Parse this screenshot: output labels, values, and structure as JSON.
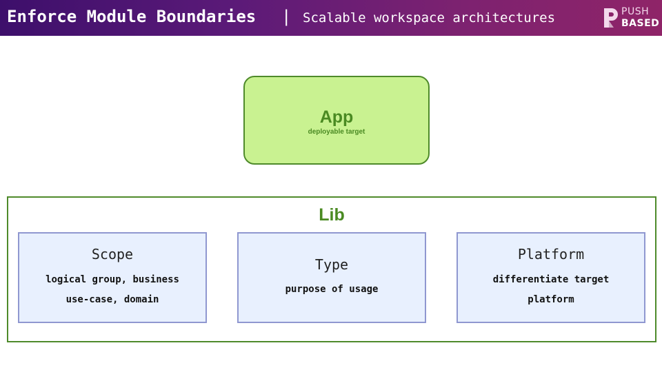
{
  "header": {
    "title": "Enforce Module Boundaries",
    "separator": "|",
    "subtitle": "Scalable workspace architectures",
    "logo": {
      "line1": "PUSH",
      "line2": "BASED",
      "icon": "push-based-logo-icon"
    }
  },
  "app": {
    "title": "App",
    "subtitle": "deployable target"
  },
  "lib": {
    "title": "Lib",
    "cards": [
      {
        "title": "Scope",
        "lines": [
          "logical group, business",
          "use-case, domain"
        ]
      },
      {
        "title": "Type",
        "lines": [
          "purpose of usage"
        ]
      },
      {
        "title": "Platform",
        "lines": [
          "differentiate target",
          "platform"
        ]
      }
    ]
  },
  "colors": {
    "header_start": "#3d0f6b",
    "header_end": "#8f2468",
    "app_fill": "#c9f291",
    "green_border": "#4e8a2a",
    "green_text": "#4a8a22",
    "card_fill": "#e8f0fe",
    "card_border": "#8f97d0"
  }
}
